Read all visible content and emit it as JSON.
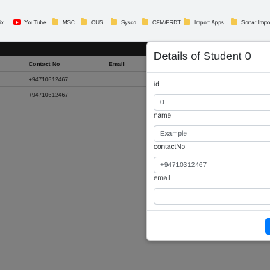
{
  "bookmarks": [
    {
      "label": "flix",
      "icon": "none"
    },
    {
      "label": "YouTube",
      "icon": "youtube-icon"
    },
    {
      "label": "MSC",
      "icon": "folder-icon"
    },
    {
      "label": "OUSL",
      "icon": "folder-icon"
    },
    {
      "label": "Sysco",
      "icon": "folder-icon"
    },
    {
      "label": "CFM/FRDT",
      "icon": "folder-icon"
    },
    {
      "label": "Import Apps",
      "icon": "folder-icon"
    },
    {
      "label": "Sonar Impor",
      "icon": "folder-icon"
    }
  ],
  "table": {
    "headers": [
      "",
      "Contact No",
      "Email"
    ],
    "rows": [
      [
        "",
        "+94710312467",
        ""
      ],
      [
        "",
        "+94710312467",
        ""
      ]
    ]
  },
  "modal": {
    "title": "Details of Student 0",
    "fields": {
      "id": {
        "label": "id",
        "value": "0"
      },
      "name": {
        "label": "name",
        "value": "Example"
      },
      "contactNo": {
        "label": "contactNo",
        "value": "+94710312467"
      },
      "email": {
        "label": "email",
        "value": ""
      }
    },
    "primary_button": ""
  },
  "colors": {
    "navbar": "#121212",
    "overlay": "#7f7f7f",
    "primary": "#007bff",
    "folder": "#f4c74d",
    "youtube": "#ff0000"
  }
}
